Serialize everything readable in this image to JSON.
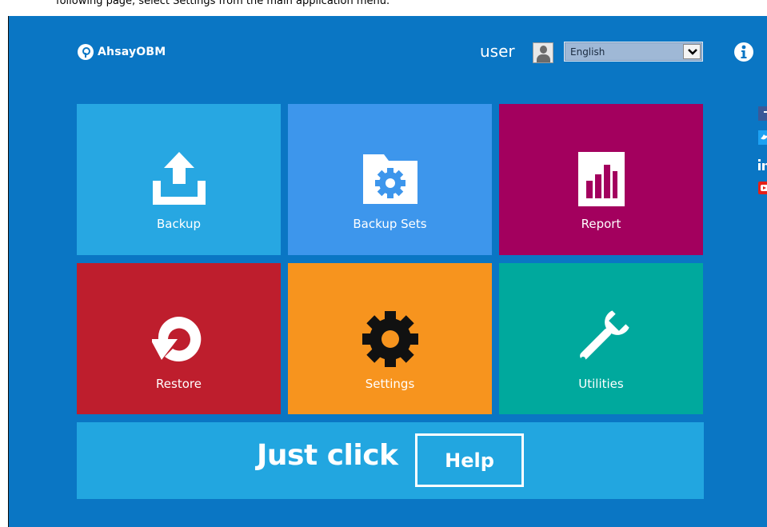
{
  "top_strip_text": "following page, select Settings from the main application menu.",
  "header": {
    "logo_text": "AhsayOBM",
    "user_label": "user",
    "language": {
      "selected": "English"
    }
  },
  "tiles": [
    {
      "label": "Backup",
      "color": "#27a7e2",
      "icon": "upload-icon"
    },
    {
      "label": "Backup Sets",
      "color": "#3d96ec",
      "icon": "folder-gear-icon"
    },
    {
      "label": "Report",
      "color": "#a3005e",
      "icon": "bar-chart-icon"
    },
    {
      "label": "Restore",
      "color": "#be1e2d",
      "icon": "restore-icon"
    },
    {
      "label": "Settings",
      "color": "#f7941e",
      "icon": "gear-icon"
    },
    {
      "label": "Utilities",
      "color": "#00a99d",
      "icon": "wrench-icon"
    }
  ],
  "help": {
    "tagline": "Just click",
    "button_label": "Help",
    "color": "#22a6e0"
  },
  "colors": {
    "background": "#0a76c4"
  },
  "social_icons": [
    "facebook-icon",
    "twitter-icon",
    "linkedin-icon",
    "youtube-icon"
  ]
}
